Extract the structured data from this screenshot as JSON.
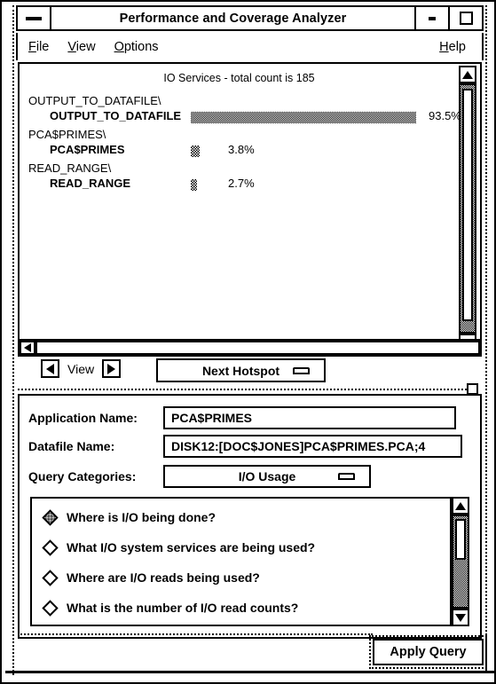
{
  "window": {
    "title": "Performance and Coverage Analyzer",
    "menu_button_icon": "window-menu-icon",
    "minimize_icon": "minimize-icon",
    "maximize_icon": "maximize-icon"
  },
  "menubar": {
    "items": [
      {
        "label": "File",
        "mnemonic": "F",
        "rest": "ile"
      },
      {
        "label": "View",
        "mnemonic": "V",
        "rest": "iew"
      },
      {
        "label": "Options",
        "mnemonic": "O",
        "rest": "ptions"
      }
    ],
    "help": {
      "label": "Help",
      "mnemonic": "H",
      "rest": "elp"
    }
  },
  "chart_data": {
    "type": "bar",
    "title": "IO Services - total count is 185",
    "orientation": "horizontal",
    "xlabel": "",
    "ylabel": "",
    "grid": false,
    "legend": null,
    "total_count": 185,
    "groups": [
      {
        "group": "OUTPUT_TO_DATAFILE\\",
        "name": "OUTPUT_TO_DATAFILE",
        "value": 93.5,
        "label": "93.5%"
      },
      {
        "group": "PCA$PRIMES\\",
        "name": "PCA$PRIMES",
        "value": 3.8,
        "label": "3.8%"
      },
      {
        "group": "READ_RANGE\\",
        "name": "READ_RANGE",
        "value": 2.7,
        "label": "2.7%"
      }
    ],
    "categories": [
      "OUTPUT_TO_DATAFILE",
      "PCA$PRIMES",
      "READ_RANGE"
    ],
    "values": [
      93.5,
      3.8,
      2.7
    ],
    "xlim": [
      0,
      100
    ]
  },
  "toolbar": {
    "prev_icon": "arrow-left-icon",
    "next_icon": "arrow-right-icon",
    "view_label": "View",
    "hotspot_label": "Next Hotspot",
    "hotspot_menu_icon": "option-menu-icon"
  },
  "form": {
    "application_name_label": "Application Name:",
    "application_name_value": "PCA$PRIMES",
    "datafile_name_label": "Datafile Name:",
    "datafile_name_value": "DISK12:[DOC$JONES]PCA$PRIMES.PCA;4",
    "query_categories_label": "Query Categories:",
    "query_categories_value": "I/O Usage"
  },
  "queries": {
    "items": [
      {
        "label": "Where is I/O being done?",
        "selected": true
      },
      {
        "label": "What I/O system services are being used?",
        "selected": false
      },
      {
        "label": "Where are I/O reads being used?",
        "selected": false
      },
      {
        "label": "What is the number of I/O read counts?",
        "selected": false
      }
    ]
  },
  "actions": {
    "apply_query_label": "Apply Query"
  },
  "scrollbars": {
    "up_icon": "scroll-up-icon",
    "down_icon": "scroll-down-icon",
    "left_icon": "scroll-left-icon"
  }
}
